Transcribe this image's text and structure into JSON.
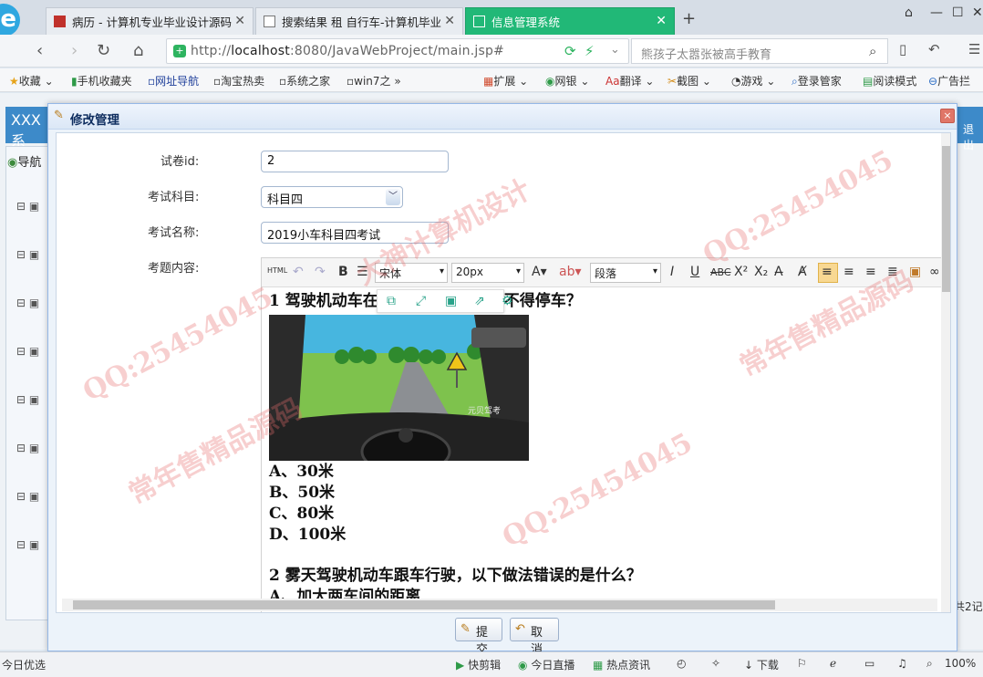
{
  "browser": {
    "tabs": [
      {
        "label": "病历 - 计算机专业毕业设计源码",
        "active": false
      },
      {
        "label": "搜索结果 租 自行车-计算机毕业",
        "active": false
      },
      {
        "label": "信息管理系统",
        "active": true
      }
    ],
    "url_prefix": "http://",
    "url_host": "localhost",
    "url_rest": ":8080/JavaWebProject/main.jsp#",
    "search_placeholder": "熊孩子太嚣张被高手教育",
    "bookmarks": [
      "收藏",
      "手机收藏夹",
      "网址导航",
      "淘宝热卖",
      "系统之家",
      "win7之",
      "扩展",
      "网银",
      "翻译",
      "截图",
      "游戏",
      "登录管家",
      "阅读模式",
      "广告拦"
    ]
  },
  "app": {
    "header_title": "XXX 系",
    "nav_title": "导航",
    "logout": "退出",
    "footer_count": "共2记"
  },
  "dialog": {
    "title": "修改管理",
    "close": "×",
    "fields": {
      "paper_id_label": "试卷id:",
      "paper_id_value": "2",
      "subject_label": "考试科目:",
      "subject_value": "科目四",
      "exam_name_label": "考试名称:",
      "exam_name_value": "2019小车科目四考试",
      "content_label": "考题内容:"
    },
    "editor": {
      "font_family": "宋体",
      "font_size": "20px",
      "paragraph": "段落",
      "html_btn": "HTML",
      "question1": "1 驾驶机动车在",
      "question1_end": "米内不得停车？",
      "image_brand": "元贝驾考",
      "options": [
        "A、30米",
        "B、50米",
        "C、80米",
        "D、100米"
      ],
      "question2": "2 雾天驾驶机动车跟车行驶，以下做法错误的是什么？",
      "question2_next": "A、加大两车间的距离"
    },
    "submit_label": "提交",
    "cancel_label": "取消"
  },
  "statusbar": {
    "left": "今日优选",
    "items": [
      "快剪辑",
      "今日直播",
      "热点资讯",
      "下载"
    ],
    "zoom": "100%"
  },
  "watermarks": [
    "常年售精品源码",
    "QQ:25454045",
    "大神计算机设计",
    "QQ:25454045",
    "常年售精品源码",
    "QQ:25454045"
  ]
}
